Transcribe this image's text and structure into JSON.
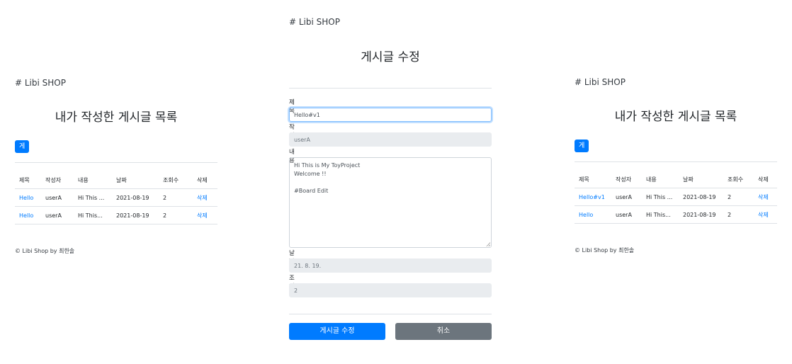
{
  "left_panel": {
    "brand": "# Libi SHOP",
    "title": "내가 작성한 게시글 목록",
    "board_button": "게시판",
    "columns": [
      "제목",
      "작성자",
      "내용",
      "날짜",
      "조회수",
      "삭제"
    ],
    "rows": [
      {
        "title": "Hello",
        "author": "userA",
        "content": "Hi This ...",
        "date": "2021-08-19",
        "views": "2",
        "delete": "삭제"
      },
      {
        "title": "Hello",
        "author": "userA",
        "content": "Hi This...",
        "date": "2021-08-19",
        "views": "2",
        "delete": "삭제"
      }
    ],
    "footer": "© Libi Shop by 최한솔"
  },
  "center_panel": {
    "brand": "# Libi SHOP",
    "title": "게시글 수정",
    "title_label": "제목",
    "title_value": "Hello#v1",
    "author_label": "작성자",
    "author_value": "userA",
    "content_label": "내용",
    "content_value": "Hi This is My ToyProject\nWelcome !!\n\n#Board Edit",
    "date_label": "날짜",
    "date_value": "21. 8. 19.",
    "views_label": "조회수",
    "views_value": "2",
    "submit_button": "게시글 수정",
    "cancel_button": "취소",
    "colors": {
      "primary": "#007bff",
      "secondary": "#6c757d"
    }
  },
  "right_panel": {
    "brand": "# Libi SHOP",
    "title": "내가 작성한 게시글 목록",
    "board_button": "게시판",
    "columns": [
      "제목",
      "작성자",
      "내용",
      "날짜",
      "조회수",
      "삭제"
    ],
    "rows": [
      {
        "title": "Hello#v1",
        "author": "userA",
        "content": "Hi This ...",
        "date": "2021-08-19",
        "views": "2",
        "delete": "삭제"
      },
      {
        "title": "Hello",
        "author": "userA",
        "content": "Hi This...",
        "date": "2021-08-19",
        "views": "2",
        "delete": "삭제"
      }
    ],
    "footer": "© Libi Shop by 최한솔"
  }
}
